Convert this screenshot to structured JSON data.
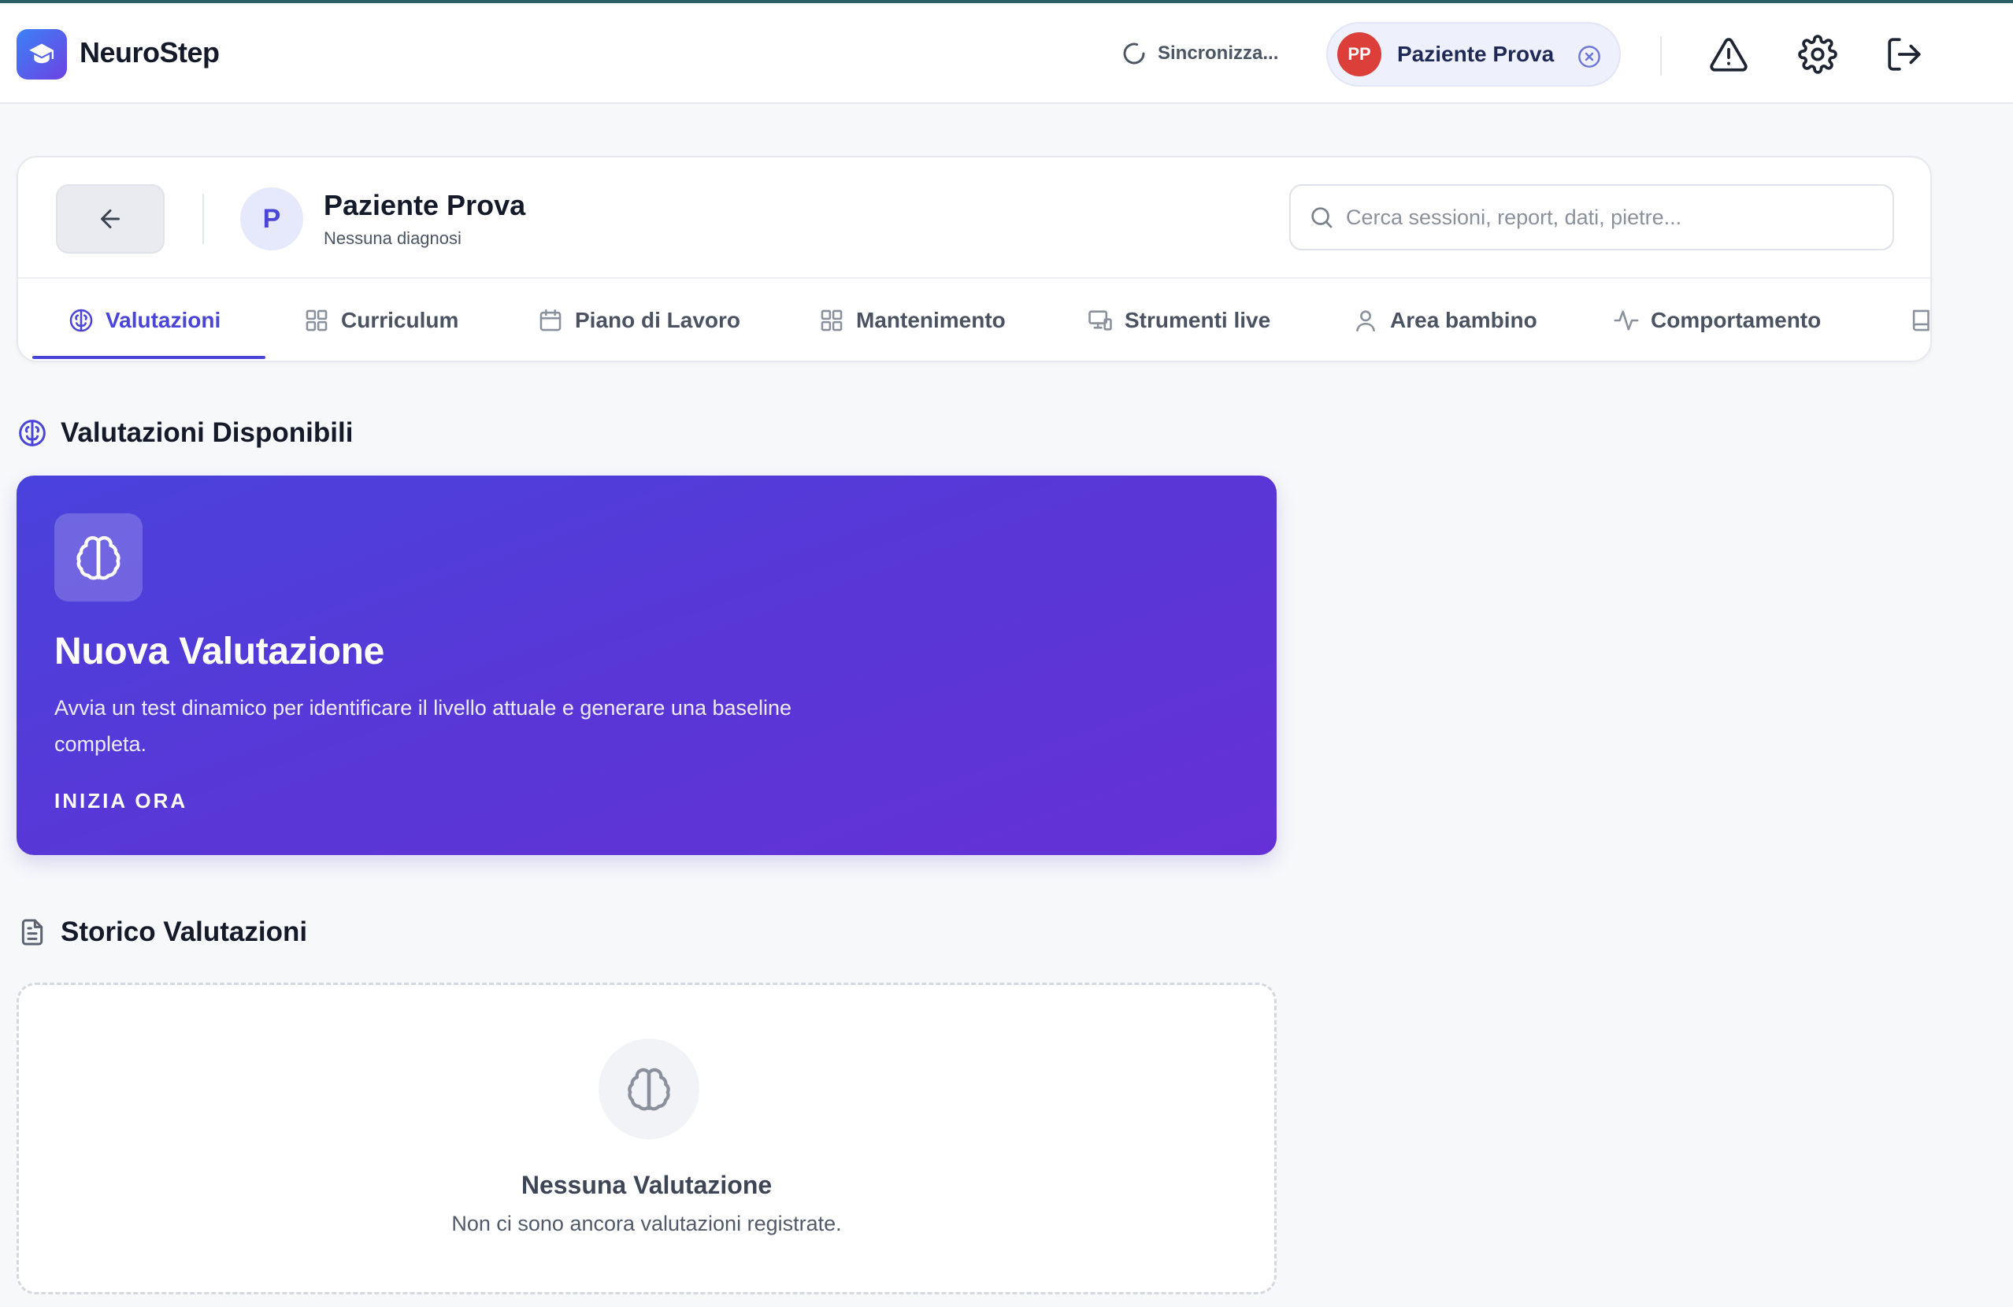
{
  "app": {
    "title": "NeuroStep",
    "logo_icon": "graduation-cap-icon",
    "accent": "#4a45d8"
  },
  "header": {
    "sync_label": "Sincronizza...",
    "patient_initials": "PP",
    "patient_name": "Paziente Prova",
    "icons": [
      "alert-triangle-icon",
      "gear-icon",
      "logout-icon"
    ]
  },
  "patient": {
    "initial": "P",
    "name": "Paziente Prova",
    "diagnosis": "Nessuna diagnosi"
  },
  "search": {
    "placeholder": "Cerca sessioni, report, dati, pietre...",
    "value": ""
  },
  "tabs": [
    {
      "label": "Valutazioni",
      "icon": "brain-icon",
      "active": true
    },
    {
      "label": "Curriculum",
      "icon": "grid-icon",
      "active": false
    },
    {
      "label": "Piano di Lavoro",
      "icon": "calendar-icon",
      "active": false
    },
    {
      "label": "Mantenimento",
      "icon": "grid-icon",
      "active": false
    },
    {
      "label": "Strumenti live",
      "icon": "devices-icon",
      "active": false
    },
    {
      "label": "Area bambino",
      "icon": "user-icon",
      "active": false
    },
    {
      "label": "Comportamento",
      "icon": "activity-icon",
      "active": false
    },
    {
      "label": "",
      "icon": "book-icon",
      "active": false
    }
  ],
  "sections": {
    "available": {
      "title": "Valutazioni Disponibili",
      "icon": "brain-icon"
    },
    "history": {
      "title": "Storico Valutazioni",
      "icon": "document-icon"
    }
  },
  "hero": {
    "title": "Nuova Valutazione",
    "description": "Avvia un test dinamico per identificare il livello attuale e generare una baseline completa.",
    "cta": "INIZIA ORA",
    "gradient": [
      "#4a42dc",
      "#6531d6"
    ]
  },
  "empty_state": {
    "title": "Nessuna Valutazione",
    "description": "Non ci sono ancora valutazioni registrate."
  }
}
